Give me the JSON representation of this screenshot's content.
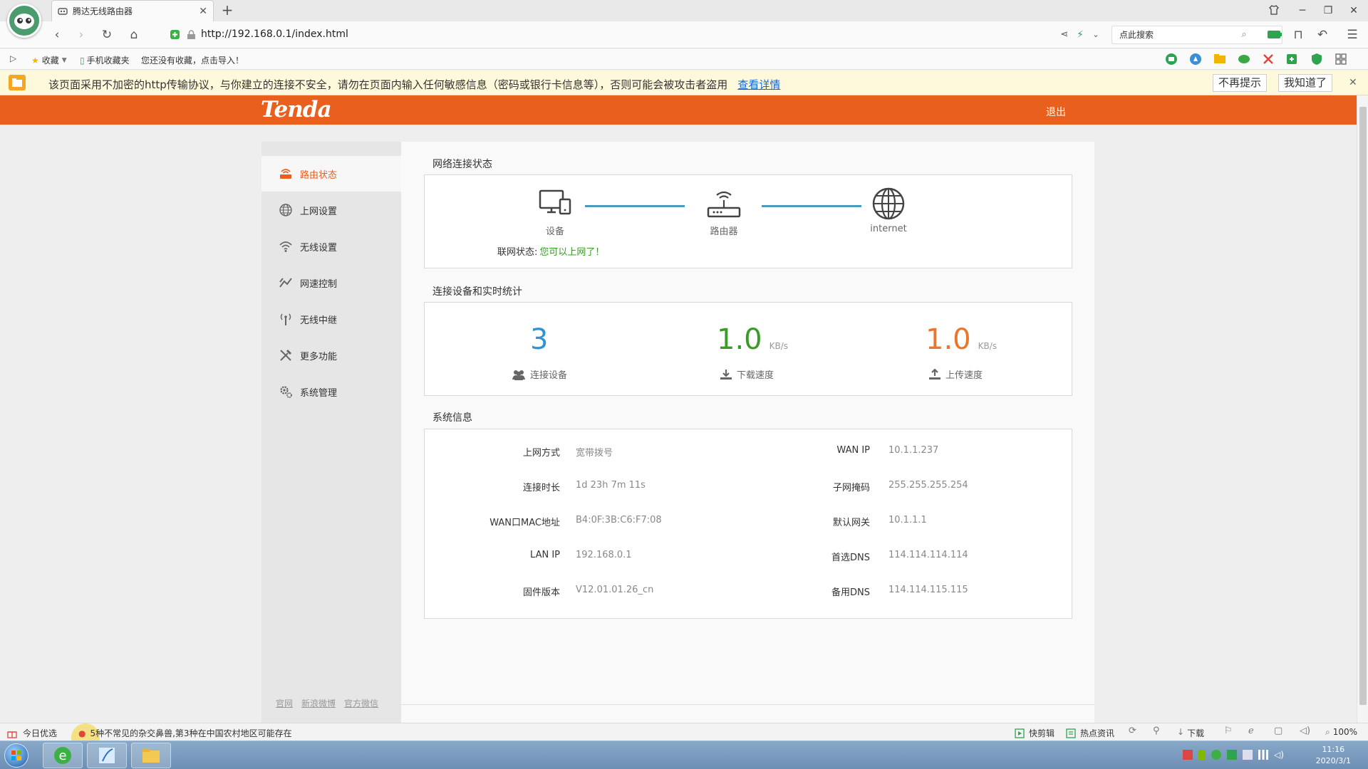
{
  "browser": {
    "tab_title": "腾达无线路由器",
    "url": "http://192.168.0.1/index.html",
    "search_placeholder": "点此搜索",
    "bookmarks": {
      "favorites": "收藏",
      "mobile": "手机收藏夹",
      "import_hint": "您还没有收藏，点击导入！"
    },
    "notice": {
      "message": "该页面采用不加密的http传输协议，与你建立的连接不安全，请勿在页面内输入任何敏感信息（密码或银行卡信息等），否则可能会被攻击者盗用",
      "link": "查看详情",
      "dont_remind": "不再提示",
      "got_it": "我知道了"
    }
  },
  "router": {
    "logo": "Tenda",
    "logout": "退出",
    "sidebar": [
      {
        "label": "路由状态",
        "icon": "router-icon",
        "active": true
      },
      {
        "label": "上网设置",
        "icon": "globe-icon"
      },
      {
        "label": "无线设置",
        "icon": "wifi-icon"
      },
      {
        "label": "网速控制",
        "icon": "speed-icon"
      },
      {
        "label": "无线中继",
        "icon": "antenna-icon"
      },
      {
        "label": "更多功能",
        "icon": "tools-icon"
      },
      {
        "label": "系统管理",
        "icon": "gear-icon"
      }
    ],
    "footer_links": [
      "官网",
      "新浪微博",
      "官方微信"
    ],
    "network_status": {
      "title": "网络连接状态",
      "device_label": "设备",
      "router_label": "路由器",
      "internet_label": "internet",
      "conn_label": "联网状态:",
      "conn_value": "您可以上网了！"
    },
    "stats": {
      "title": "连接设备和实时统计",
      "devices": "3",
      "devices_label": "连接设备",
      "download": "1.0",
      "download_unit": "KB/s",
      "download_label": "下载速度",
      "upload": "1.0",
      "upload_unit": "KB/s",
      "upload_label": "上传速度"
    },
    "system_info": {
      "title": "系统信息",
      "left": [
        {
          "label": "上网方式",
          "value": "宽带拨号"
        },
        {
          "label": "连接时长",
          "value": "1d 23h 7m 11s"
        },
        {
          "label": "WAN口MAC地址",
          "value": "B4:0F:3B:C6:F7:08"
        },
        {
          "label": "LAN IP",
          "value": "192.168.0.1"
        },
        {
          "label": "固件版本",
          "value": "V12.01.01.26_cn"
        }
      ],
      "right": [
        {
          "label": "WAN IP",
          "value": "10.1.1.237"
        },
        {
          "label": "子网掩码",
          "value": "255.255.255.254"
        },
        {
          "label": "默认网关",
          "value": "10.1.1.1"
        },
        {
          "label": "首选DNS",
          "value": "114.114.114.114"
        },
        {
          "label": "备用DNS",
          "value": "114.114.115.115"
        }
      ]
    }
  },
  "statusbar": {
    "today": "今日优选",
    "news": "5种不常见的杂交鼻兽,第3种在中国农村地区可能存在",
    "clip": "快剪辑",
    "hot": "热点资讯",
    "download": "下载",
    "zoom": "100%"
  },
  "taskbar": {
    "time": "11:16",
    "date": "2020/3/1"
  },
  "colors": {
    "brand_orange": "#e9601e",
    "devices_blue": "#2e95d3",
    "download_green": "#3a9b28",
    "upload_orange": "#e9762b",
    "status_green": "#3a9b28"
  }
}
